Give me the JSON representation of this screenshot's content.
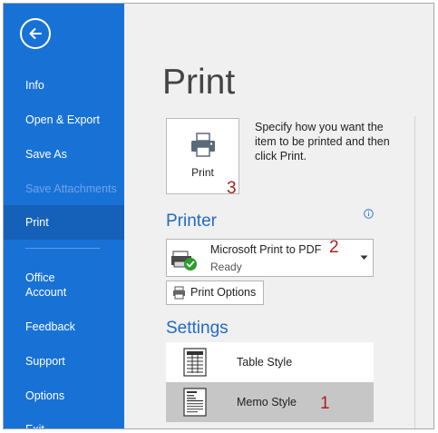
{
  "sidebar": {
    "back_label": "Back",
    "items": [
      {
        "label": "Info"
      },
      {
        "label": "Open & Export"
      },
      {
        "label": "Save As"
      },
      {
        "label": "Save Attachments",
        "disabled": true
      },
      {
        "label": "Print",
        "active": true
      },
      {
        "label_line1": "Office",
        "label_line2": "Account"
      },
      {
        "label": "Feedback"
      },
      {
        "label": "Support"
      },
      {
        "label": "Options"
      },
      {
        "label": "Exit"
      }
    ]
  },
  "main": {
    "title": "Print",
    "print_button_label": "Print",
    "description": "Specify how you want the item to be printed and then click Print.",
    "printer_heading": "Printer",
    "printer": {
      "name": "Microsoft Print to PDF",
      "status": "Ready"
    },
    "print_options_label": "Print Options",
    "settings_heading": "Settings",
    "styles": [
      {
        "label": "Table Style"
      },
      {
        "label": "Memo Style",
        "selected": true
      }
    ]
  },
  "annotations": {
    "step1": "1",
    "step2": "2",
    "step3": "3"
  },
  "colors": {
    "sidebar": "#1872d6",
    "sidebar_active": "#1560b8",
    "heading_blue": "#1f6bc4",
    "annotation_red": "#b01e1e"
  },
  "icons": [
    "back-arrow-icon",
    "printer-icon",
    "info-icon",
    "printer-ready-icon",
    "chevron-down-icon",
    "print-options-icon",
    "table-style-icon",
    "memo-style-icon"
  ]
}
